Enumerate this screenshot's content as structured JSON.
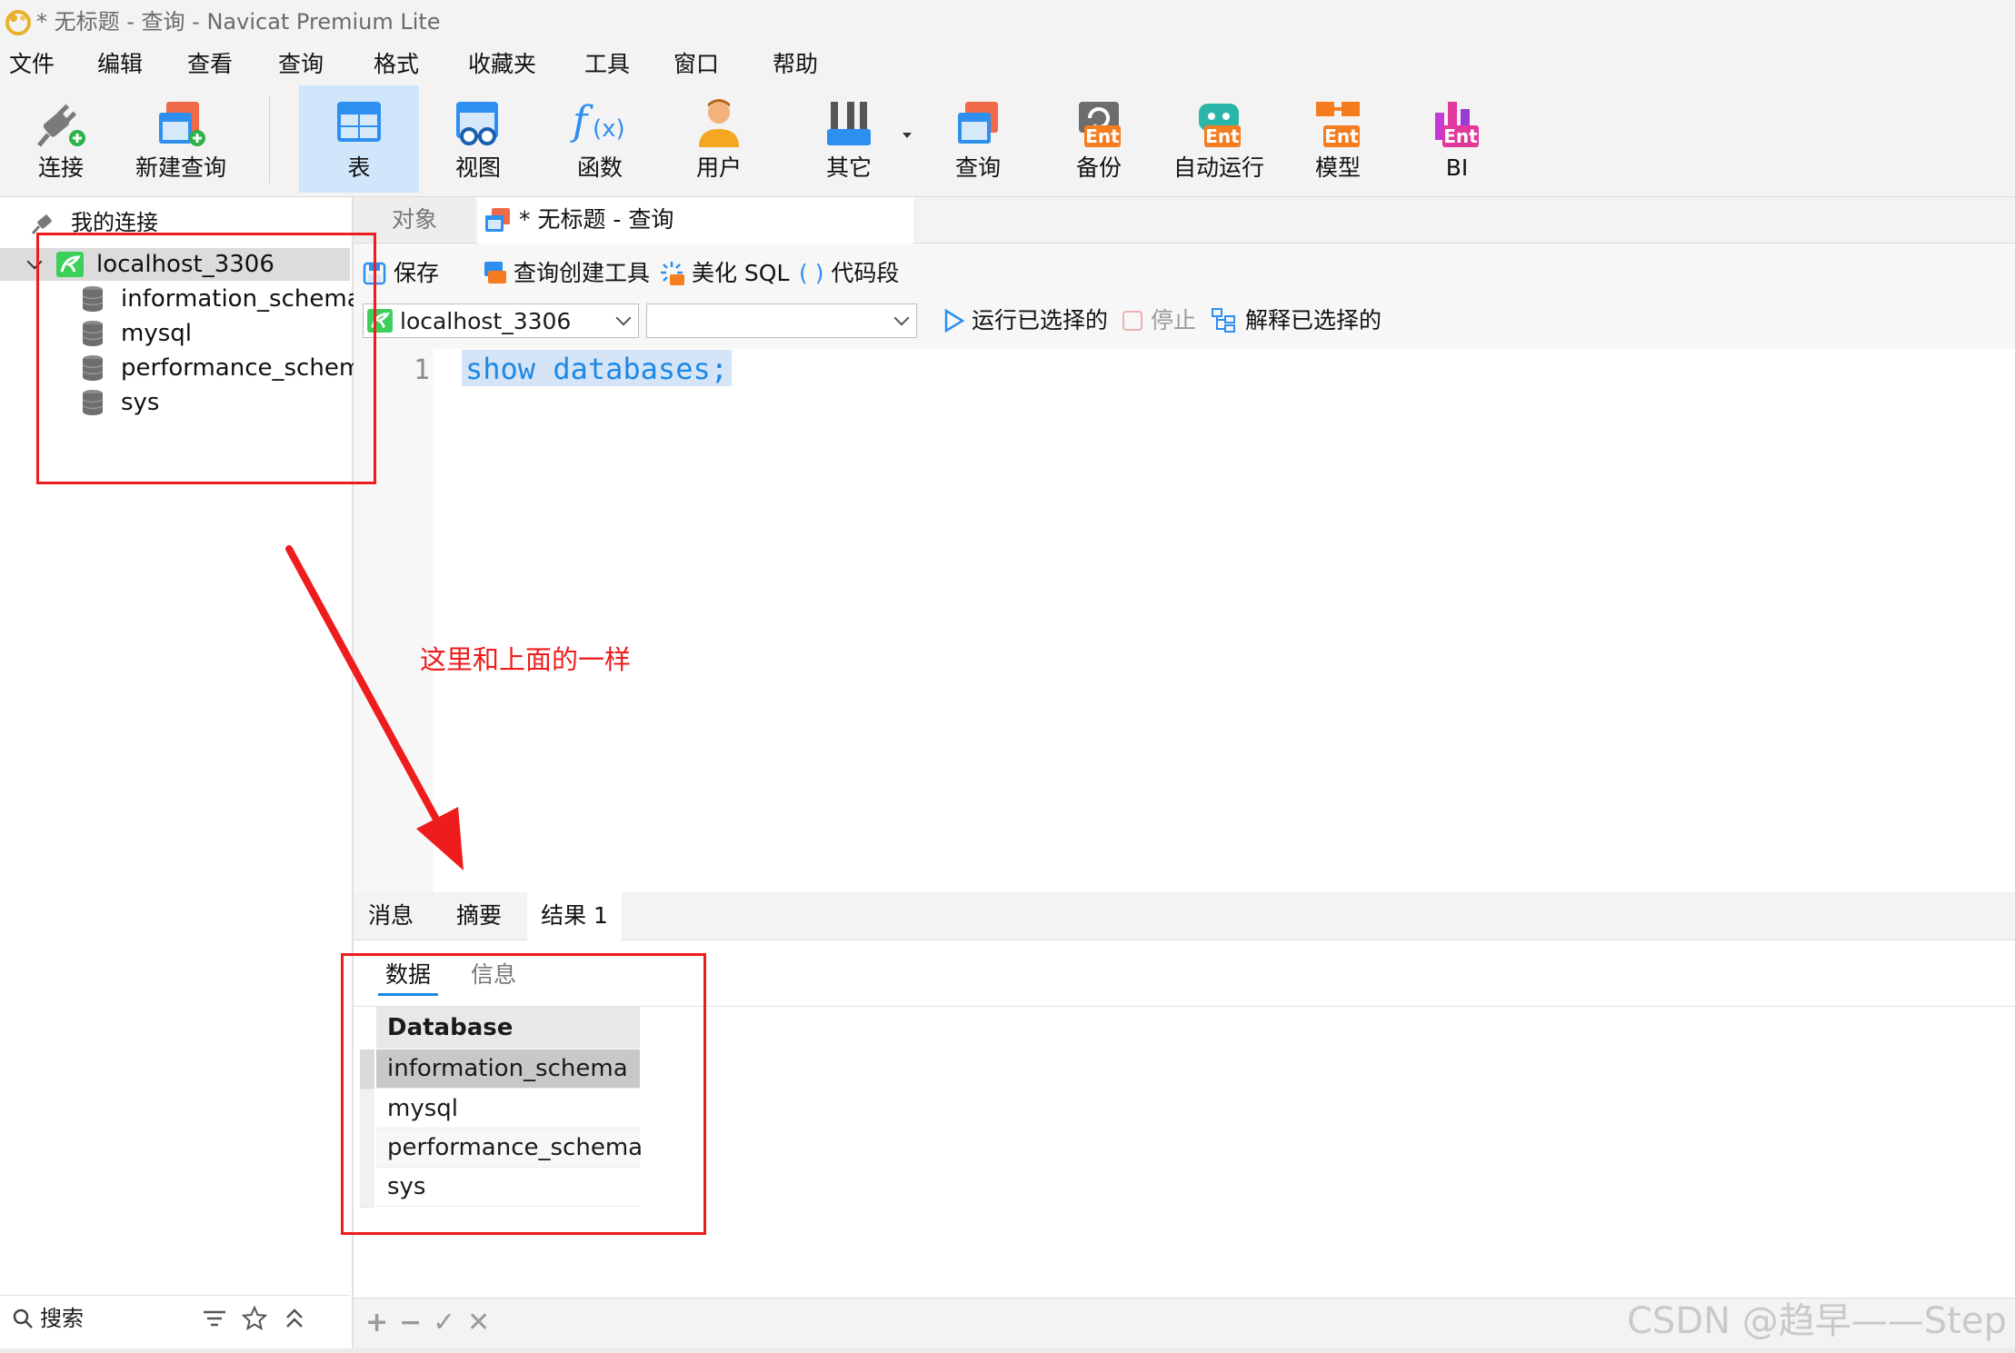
{
  "window": {
    "title": "* 无标题 - 查询 - Navicat Premium Lite"
  },
  "menu": [
    "文件",
    "编辑",
    "查看",
    "查询",
    "格式",
    "收藏夹",
    "工具",
    "窗口",
    "帮助"
  ],
  "toolbar": {
    "connect": "连接",
    "new_query": "新建查询",
    "table": "表",
    "view": "视图",
    "function": "函数",
    "user": "用户",
    "other": "其它",
    "query": "查询",
    "backup": "备份",
    "automation": "自动运行",
    "model": "模型",
    "bi": "BI",
    "ent_badge": "Ent"
  },
  "sidebar": {
    "header": "我的连接",
    "connection": "localhost_3306",
    "databases": [
      "information_schema",
      "mysql",
      "performance_schema",
      "sys"
    ],
    "search_label": "搜索"
  },
  "tabs": {
    "objects": "对象",
    "query_tab": "* 无标题 - 查询"
  },
  "query_toolbar": {
    "save": "保存",
    "query_builder": "查询创建工具",
    "beautify": "美化 SQL",
    "snippet": "代码段",
    "connection_value": "localhost_3306",
    "database_value": "",
    "run_selected": "运行已选择的",
    "stop": "停止",
    "explain_selected": "解释已选择的"
  },
  "editor": {
    "line_numbers": [
      "1"
    ],
    "code": "show databases;"
  },
  "results": {
    "tabs": [
      "消息",
      "摘要",
      "结果 1"
    ],
    "active_tab": "结果 1",
    "subtabs": [
      "数据",
      "信息"
    ],
    "column_header": "Database",
    "rows": [
      "information_schema",
      "mysql",
      "performance_schema",
      "sys"
    ],
    "grid_buttons": [
      "+",
      "−",
      "✓",
      "✕"
    ]
  },
  "annotation": {
    "text": "这里和上面的一样",
    "color": "#ee1c1c"
  },
  "watermark": "CSDN @趋早——Step",
  "colors": {
    "accent": "#1e88e5",
    "active_tool": "#cfe6fb",
    "annotation_red": "#ee1c1c",
    "connection_green": "#3ccf5a"
  }
}
